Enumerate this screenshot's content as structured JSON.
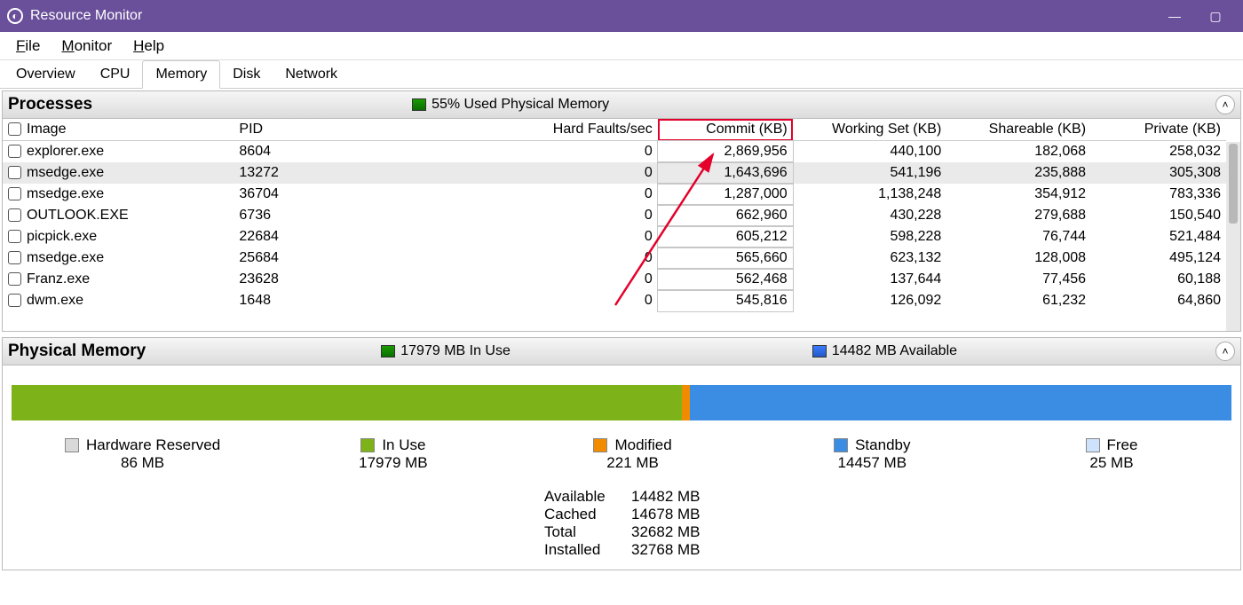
{
  "window": {
    "title": "Resource Monitor"
  },
  "menubar": {
    "file": "File",
    "monitor": "Monitor",
    "help": "Help"
  },
  "tabs": {
    "overview": "Overview",
    "cpu": "CPU",
    "memory": "Memory",
    "disk": "Disk",
    "network": "Network",
    "active": "memory"
  },
  "processes_section": {
    "title": "Processes",
    "usage_label": "55% Used Physical Memory",
    "columns": {
      "image": "Image",
      "pid": "PID",
      "hf": "Hard Faults/sec",
      "commit": "Commit (KB)",
      "ws": "Working Set (KB)",
      "share": "Shareable (KB)",
      "priv": "Private (KB)"
    },
    "highlight_column": "commit",
    "selected_index": 1,
    "rows": [
      {
        "image": "explorer.exe",
        "pid": "8604",
        "hf": "0",
        "commit": "2,869,956",
        "ws": "440,100",
        "share": "182,068",
        "priv": "258,032"
      },
      {
        "image": "msedge.exe",
        "pid": "13272",
        "hf": "0",
        "commit": "1,643,696",
        "ws": "541,196",
        "share": "235,888",
        "priv": "305,308"
      },
      {
        "image": "msedge.exe",
        "pid": "36704",
        "hf": "0",
        "commit": "1,287,000",
        "ws": "1,138,248",
        "share": "354,912",
        "priv": "783,336"
      },
      {
        "image": "OUTLOOK.EXE",
        "pid": "6736",
        "hf": "0",
        "commit": "662,960",
        "ws": "430,228",
        "share": "279,688",
        "priv": "150,540"
      },
      {
        "image": "picpick.exe",
        "pid": "22684",
        "hf": "0",
        "commit": "605,212",
        "ws": "598,228",
        "share": "76,744",
        "priv": "521,484"
      },
      {
        "image": "msedge.exe",
        "pid": "25684",
        "hf": "0",
        "commit": "565,660",
        "ws": "623,132",
        "share": "128,008",
        "priv": "495,124"
      },
      {
        "image": "Franz.exe",
        "pid": "23628",
        "hf": "0",
        "commit": "562,468",
        "ws": "137,644",
        "share": "77,456",
        "priv": "60,188"
      },
      {
        "image": "dwm.exe",
        "pid": "1648",
        "hf": "0",
        "commit": "545,816",
        "ws": "126,092",
        "share": "61,232",
        "priv": "64,860"
      }
    ]
  },
  "physical_section": {
    "title": "Physical Memory",
    "in_use_label": "17979 MB In Use",
    "avail_label": "14482 MB Available",
    "legend": {
      "hw": {
        "label": "Hardware Reserved",
        "value": "86 MB"
      },
      "inuse": {
        "label": "In Use",
        "value": "17979 MB"
      },
      "mod": {
        "label": "Modified",
        "value": "221 MB"
      },
      "standby": {
        "label": "Standby",
        "value": "14457 MB"
      },
      "free": {
        "label": "Free",
        "value": "25 MB"
      }
    },
    "stats": {
      "available": {
        "label": "Available",
        "value": "14482 MB"
      },
      "cached": {
        "label": "Cached",
        "value": "14678 MB"
      },
      "total": {
        "label": "Total",
        "value": "32682 MB"
      },
      "installed": {
        "label": "Installed",
        "value": "32768 MB"
      }
    }
  },
  "chart_data": {
    "type": "bar",
    "title": "Physical Memory Usage",
    "categories": [
      "Hardware Reserved",
      "In Use",
      "Modified",
      "Standby",
      "Free"
    ],
    "values": [
      86,
      17979,
      221,
      14457,
      25
    ],
    "unit": "MB",
    "total": 32768
  }
}
